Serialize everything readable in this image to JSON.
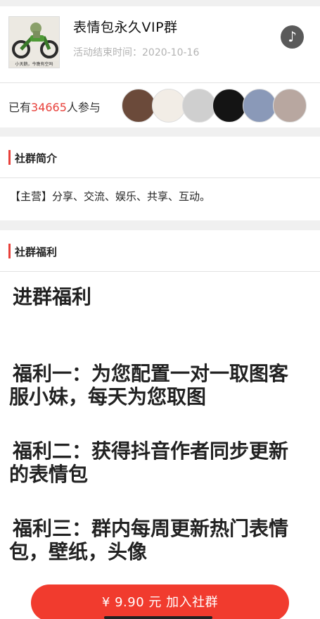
{
  "group": {
    "title": "表情包永久VIP群",
    "end_label": "活动结束时间：",
    "end_date": "2020-10-16",
    "avatar_caption": "小天鹅，今晚有空吗",
    "music_icon": "music-note-icon"
  },
  "participants": {
    "prefix": "已有",
    "count": "34665",
    "suffix": "人参与"
  },
  "intro": {
    "heading": "社群简介",
    "text": "【主营】分享、交流、娱乐、共享、互动。"
  },
  "benefits": {
    "heading": "社群福利",
    "title": "进群福利",
    "item1_a": "福利一：为您配置一对一取图客",
    "item1_b": "服小妹，每天为您取图",
    "item2_a": "福利二：获得抖音作者同步更新",
    "item2_b": "的表情包",
    "item3_a": "福利三：群内每周更新热门表情",
    "item3_b": "包，壁纸，头像"
  },
  "join": {
    "label": "¥ 9.90 元  加入社群"
  },
  "colors": {
    "accent": "#e8403a",
    "button": "#f13b2e"
  }
}
